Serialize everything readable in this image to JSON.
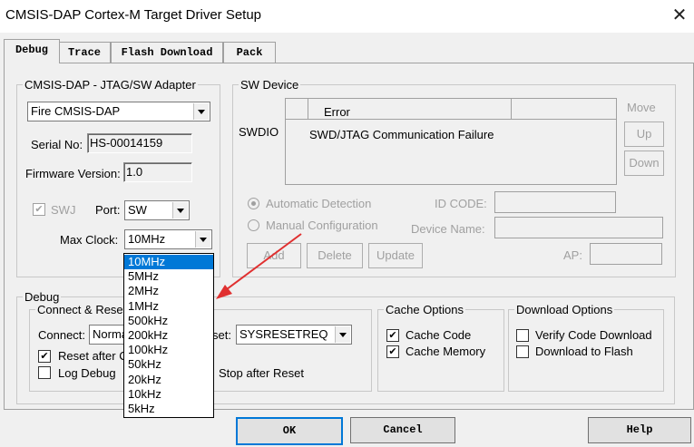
{
  "window": {
    "title": "CMSIS-DAP Cortex-M Target Driver Setup",
    "close_glyph": "✕"
  },
  "tabs": [
    "Debug",
    "Trace",
    "Flash Download",
    "Pack"
  ],
  "adapter": {
    "legend": "CMSIS-DAP - JTAG/SW Adapter",
    "selected": "Fire CMSIS-DAP",
    "serial_label": "Serial No:",
    "serial_value": "HS-00014159",
    "firmware_label": "Firmware Version:",
    "firmware_value": "1.0",
    "swj_label": "SWJ",
    "port_label": "Port:",
    "port_value": "SW",
    "maxclock_label": "Max Clock:",
    "maxclock_value": "10MHz",
    "clock_options": [
      "10MHz",
      "5MHz",
      "2MHz",
      "1MHz",
      "500kHz",
      "200kHz",
      "100kHz",
      "50kHz",
      "20kHz",
      "10kHz",
      "5kHz"
    ]
  },
  "sw_device": {
    "legend": "SW Device",
    "swdio_label": "SWDIO",
    "error_header": "Error",
    "error_text": "SWD/JTAG Communication Failure",
    "move_label": "Move",
    "up_label": "Up",
    "down_label": "Down",
    "auto_detect": "Automatic Detection",
    "manual_config": "Manual Configuration",
    "idcode_label": "ID CODE:",
    "devname_label": "Device Name:",
    "ap_label": "AP:",
    "add_label": "Add",
    "delete_label": "Delete",
    "update_label": "Update"
  },
  "debug": {
    "legend": "Debug",
    "connect_reset_legend": "Connect & Rese",
    "connect_label": "Connect:",
    "connect_value": "Norma",
    "reset_label": "set:",
    "reset_value": "SYSRESETREQ",
    "reset_after": "Reset after C",
    "log_debug": "Log Debug",
    "stop_after_reset": "Stop after Reset"
  },
  "cache": {
    "legend": "Cache Options",
    "cache_code": "Cache Code",
    "cache_memory": "Cache Memory"
  },
  "download": {
    "legend": "Download Options",
    "verify": "Verify Code Download",
    "to_flash": "Download to Flash"
  },
  "buttons": {
    "ok": "OK",
    "cancel": "Cancel",
    "help": "Help"
  },
  "colors": {
    "accent": "#0078d7",
    "arrow": "#e03030"
  }
}
